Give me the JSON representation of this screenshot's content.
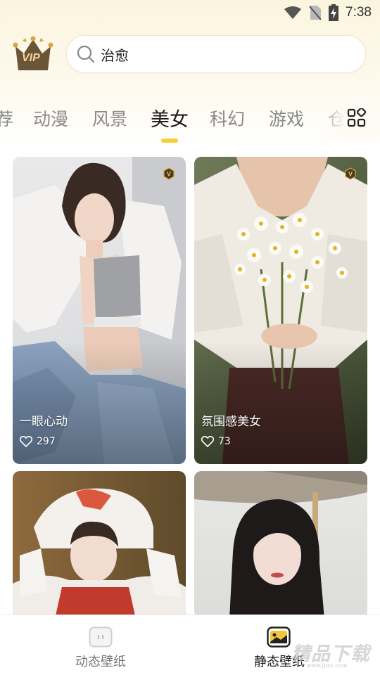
{
  "status_bar": {
    "time": "7:38",
    "icons": [
      "wifi-icon",
      "no-sim-icon",
      "battery-charging-icon"
    ]
  },
  "header": {
    "vip_badge": {
      "icon": "crown-icon",
      "label": "VIP"
    },
    "search": {
      "value": "治愈",
      "icon": "search-icon"
    }
  },
  "tabs": {
    "items": [
      {
        "label": "荐"
      },
      {
        "label": "动漫"
      },
      {
        "label": "风景"
      },
      {
        "label": "美女"
      },
      {
        "label": "科幻"
      },
      {
        "label": "游戏"
      },
      {
        "label": "仓"
      }
    ],
    "active_index": 3,
    "more_icon": "grid-icon",
    "accent_color": "#f5cf3a"
  },
  "wallpapers": [
    {
      "title": "一眼心动",
      "likes": "297",
      "vip": true,
      "like_icon": "heart-outline-icon"
    },
    {
      "title": "氛围感美女",
      "likes": "73",
      "vip": true,
      "like_icon": "heart-outline-icon"
    },
    {
      "title": "",
      "likes": "",
      "vip": false
    },
    {
      "title": "",
      "likes": "",
      "vip": false
    }
  ],
  "bottom_nav": {
    "items": [
      {
        "label": "动态壁纸",
        "icon": "live-wallpaper-icon",
        "active": false
      },
      {
        "label": "静态壁纸",
        "icon": "static-wallpaper-icon",
        "active": true
      }
    ]
  },
  "watermark": {
    "text": "精品下载",
    "sub": "www.jpxz.com"
  }
}
